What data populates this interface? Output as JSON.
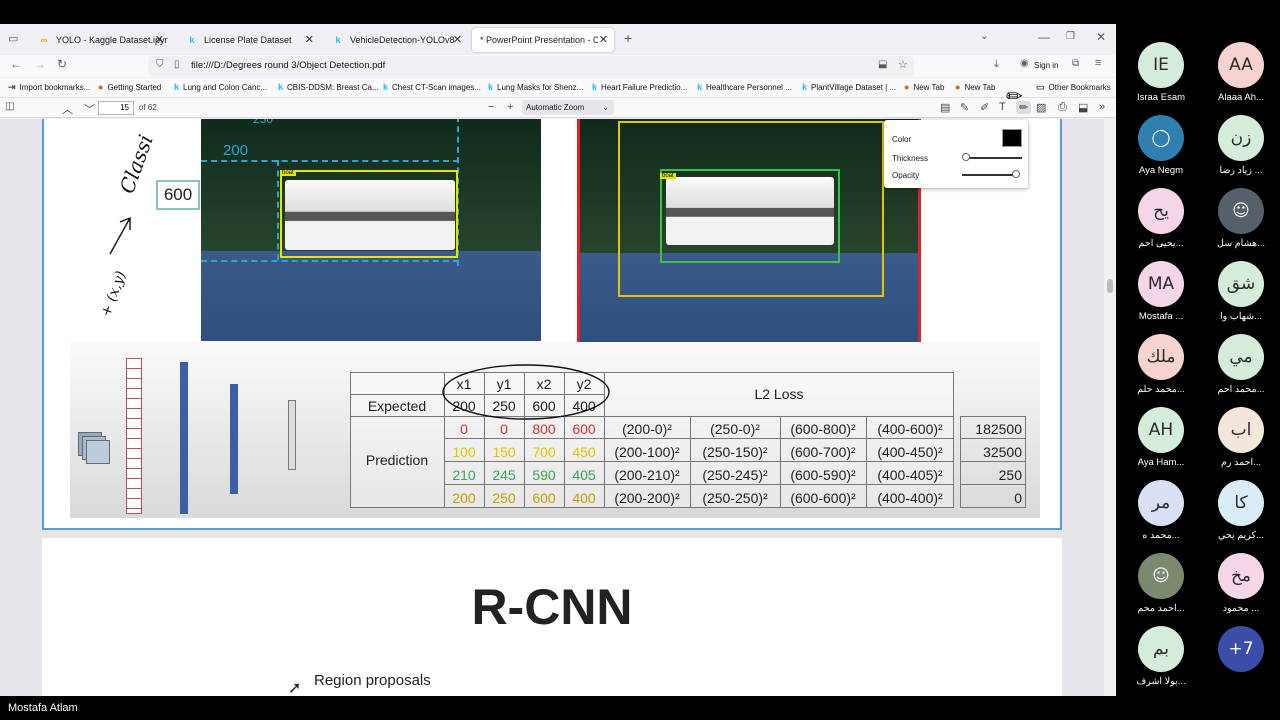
{
  "tabs": [
    {
      "label": "YOLO - Kaggle Dataset.ipynb - I",
      "icon": "co"
    },
    {
      "label": "License Plate Dataset",
      "icon": "k"
    },
    {
      "label": "VehicleDetection-YOLOv8",
      "icon": "k"
    },
    {
      "label": "* PowerPoint Presentation - Object D",
      "icon": ""
    }
  ],
  "url": "file:///D:/Degrees round 3/Object Detection.pdf",
  "sign_in": "Sign in",
  "bookmarks": [
    "Import bookmarks...",
    "Getting Started",
    "Lung and Colon Canc...",
    "CBIS-DDSM: Breast Ca...",
    "Chest CT-Scan images...",
    "Lung Masks for Shenz...",
    "Heart Failure Predictio...",
    "Healthcare Personnel ...",
    "PlantVillage Dataset | ...",
    "New Tab",
    "New Tab",
    "Other Bookmarks"
  ],
  "pdf": {
    "page": "15",
    "of": "of 62",
    "zoom": "Automatic Zoom"
  },
  "draw_popup": {
    "color_label": "Color",
    "thickness_label": "Thickness",
    "opacity_label": "Opacity",
    "color_value": "#000000"
  },
  "slide": {
    "val_600": "600",
    "label_200": "200",
    "label_250": "250",
    "boat_label": "boat",
    "handwriting": [
      "Classi",
      "+ (x,y)"
    ],
    "headers": [
      "x1",
      "y1",
      "x2",
      "y2"
    ],
    "l2_header": "L2 Loss",
    "expected_label": "Expected",
    "expected": [
      "200",
      "250",
      "600",
      "400"
    ],
    "prediction_label": "Prediction",
    "predictions": [
      {
        "vals": [
          "0",
          "0",
          "800",
          "600"
        ],
        "colors": [
          "#e03030",
          "#e03030",
          "#e03030",
          "#e03030"
        ],
        "terms": [
          "(200-0)²",
          "(250-0)²",
          "(600-800)²",
          "(400-600)²"
        ],
        "loss": "182500"
      },
      {
        "vals": [
          "100",
          "150",
          "700",
          "450"
        ],
        "colors": [
          "#e6c400",
          "#e6c400",
          "#e6c400",
          "#e6c400"
        ],
        "terms": [
          "(200-100)²",
          "(250-150)²",
          "(600-700)²",
          "(400-450)²"
        ],
        "loss": "32500"
      },
      {
        "vals": [
          "210",
          "245",
          "590",
          "405"
        ],
        "colors": [
          "#3aa655",
          "#3aa655",
          "#3aa655",
          "#3aa655"
        ],
        "terms": [
          "(200-210)²",
          "(250-245)²",
          "(600-590)²",
          "(400-405)²"
        ],
        "loss": "250"
      },
      {
        "vals": [
          "200",
          "250",
          "600",
          "400"
        ],
        "colors": [
          "#c8a000",
          "#c8a000",
          "#c8a000",
          "#c8a000"
        ],
        "terms": [
          "(200-200)²",
          "(250-250)²",
          "(600-600)²",
          "(400-400)²"
        ],
        "loss": "0"
      }
    ]
  },
  "slide2": {
    "title": "R-CNN",
    "region": "Region proposals"
  },
  "participants": [
    {
      "initials": "IE",
      "name": "Israa Esam",
      "color": "#d4ecd9",
      "text": "#2a2a2a"
    },
    {
      "initials": "AA",
      "name": "Alaaa Ah...",
      "color": "#f7d3cf",
      "text": "#2a2a2a"
    },
    {
      "initials": "",
      "name": "Aya Negm",
      "color": "#2f7fb0",
      "text": "#fff",
      "icon": "person-icon"
    },
    {
      "initials": "زن",
      "name": "زياد رضا ...",
      "color": "#d4ecd9",
      "text": "#2a2a2a"
    },
    {
      "initials": "يح",
      "name": "يحيى احم...",
      "color": "#f5d5e8",
      "text": "#2a2a2a"
    },
    {
      "initials": "",
      "name": "هشام سل...",
      "color": "#55606a",
      "text": "#fff",
      "icon": "photo-avatar"
    },
    {
      "initials": "MA",
      "name": "Mostafa ...",
      "color": "#f5d5e8",
      "text": "#2a2a2a"
    },
    {
      "initials": "شق",
      "name": "شهاب وا...",
      "color": "#d4ecd9",
      "text": "#2a2a2a"
    },
    {
      "initials": "ملك",
      "name": "محمد حلم...",
      "color": "#f7d3cf",
      "text": "#2a2a2a"
    },
    {
      "initials": "مي",
      "name": "محمد احم...",
      "color": "#d4ecd9",
      "text": "#2a2a2a"
    },
    {
      "initials": "AH",
      "name": "Aya Ham...",
      "color": "#d4ecd9",
      "text": "#2a2a2a"
    },
    {
      "initials": "اب",
      "name": "احمد رم...",
      "color": "#f3e7dc",
      "text": "#2a2a2a"
    },
    {
      "initials": "مر",
      "name": "محمد ه...",
      "color": "#d9dff5",
      "text": "#2a2a2a"
    },
    {
      "initials": "كا",
      "name": "كريم يحي...",
      "color": "#d9ecf7",
      "text": "#2a2a2a"
    },
    {
      "initials": "",
      "name": "احمد محم...",
      "color": "#7a8a70",
      "text": "#fff",
      "icon": "photo-avatar"
    },
    {
      "initials": "مخ",
      "name": "محمود ...",
      "color": "#f5d5e8",
      "text": "#2a2a2a"
    },
    {
      "initials": "بم",
      "name": "بولا اشرف...",
      "color": "#d4ecd9",
      "text": "#2a2a2a"
    },
    {
      "initials": "+7",
      "name": "",
      "color": "#3b4da8",
      "text": "#fff"
    }
  ],
  "presenter": "Mostafa Atlam"
}
